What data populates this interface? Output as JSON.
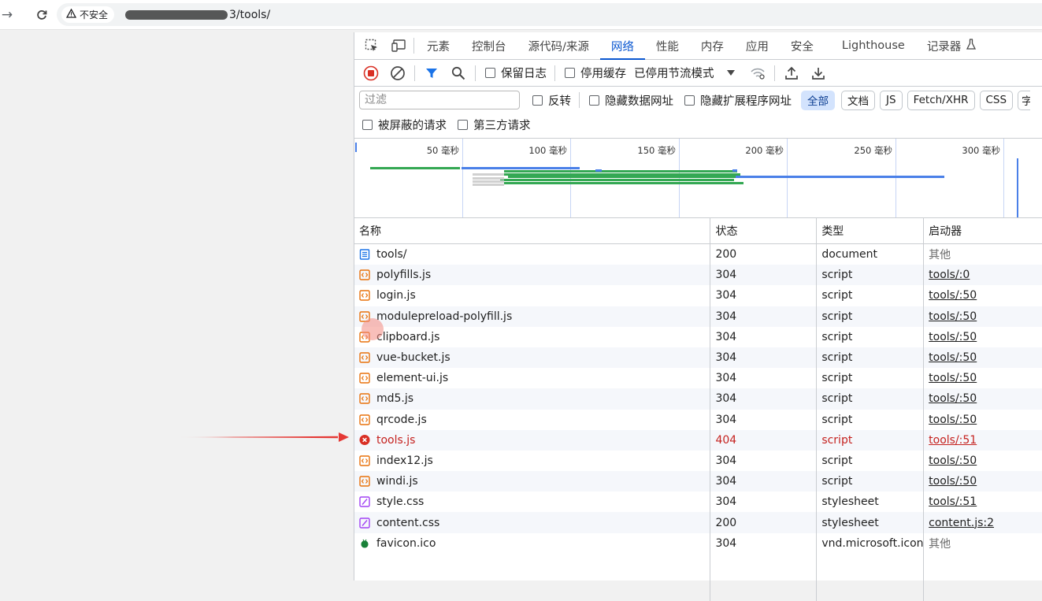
{
  "browser": {
    "security_label": "不安全",
    "url_suffix": "3/tools/"
  },
  "devtools": {
    "tabs": [
      "元素",
      "控制台",
      "源代码/来源",
      "网络",
      "性能",
      "内存",
      "应用",
      "安全",
      "Lighthouse",
      "记录器"
    ],
    "active_tab": "网络",
    "toolbar": {
      "preserve_log": "保留日志",
      "disable_cache": "停用缓存",
      "throttling": "已停用节流模式"
    },
    "filter": {
      "placeholder": "过滤",
      "invert": "反转",
      "hide_data_urls": "隐藏数据网址",
      "hide_ext_urls": "隐藏扩展程序网址",
      "types": [
        "全部",
        "文档",
        "JS",
        "Fetch/XHR",
        "CSS",
        "字"
      ],
      "active_type": "全部",
      "blocked_requests": "被屏蔽的请求",
      "third_party": "第三方请求"
    },
    "overview": {
      "ticks": [
        "50 毫秒",
        "100 毫秒",
        "150 毫秒",
        "200 毫秒",
        "250 毫秒",
        "300 毫秒"
      ]
    },
    "table": {
      "headers": [
        "名称",
        "状态",
        "类型",
        "启动器"
      ],
      "rows": [
        {
          "name": "tools/",
          "status": "200",
          "type": "document",
          "initiator": "其他",
          "icon": "document-icon",
          "kind": "doc"
        },
        {
          "name": "polyfills.js",
          "status": "304",
          "type": "script",
          "initiator": "tools/:0",
          "icon": "script-icon",
          "kind": "js"
        },
        {
          "name": "login.js",
          "status": "304",
          "type": "script",
          "initiator": "tools/:50",
          "icon": "script-icon",
          "kind": "js"
        },
        {
          "name": "modulepreload-polyfill.js",
          "status": "304",
          "type": "script",
          "initiator": "tools/:50",
          "icon": "script-icon",
          "kind": "js"
        },
        {
          "name": "clipboard.js",
          "status": "304",
          "type": "script",
          "initiator": "tools/:50",
          "icon": "script-icon",
          "kind": "js"
        },
        {
          "name": "vue-bucket.js",
          "status": "304",
          "type": "script",
          "initiator": "tools/:50",
          "icon": "script-icon",
          "kind": "js"
        },
        {
          "name": "element-ui.js",
          "status": "304",
          "type": "script",
          "initiator": "tools/:50",
          "icon": "script-icon",
          "kind": "js"
        },
        {
          "name": "md5.js",
          "status": "304",
          "type": "script",
          "initiator": "tools/:50",
          "icon": "script-icon",
          "kind": "js"
        },
        {
          "name": "qrcode.js",
          "status": "304",
          "type": "script",
          "initiator": "tools/:50",
          "icon": "script-icon",
          "kind": "js"
        },
        {
          "name": "tools.js",
          "status": "404",
          "type": "script",
          "initiator": "tools/:51",
          "icon": "error-icon",
          "kind": "err"
        },
        {
          "name": "index12.js",
          "status": "304",
          "type": "script",
          "initiator": "tools/:50",
          "icon": "script-icon",
          "kind": "js"
        },
        {
          "name": "windi.js",
          "status": "304",
          "type": "script",
          "initiator": "tools/:50",
          "icon": "script-icon",
          "kind": "js"
        },
        {
          "name": "style.css",
          "status": "304",
          "type": "stylesheet",
          "initiator": "tools/:51",
          "icon": "stylesheet-icon",
          "kind": "css"
        },
        {
          "name": "content.css",
          "status": "200",
          "type": "stylesheet",
          "initiator": "content.js:2",
          "icon": "stylesheet-icon",
          "kind": "css"
        },
        {
          "name": "favicon.ico",
          "status": "304",
          "type": "vnd.microsoft.icon",
          "initiator": "其他",
          "icon": "favicon-icon",
          "kind": "ico"
        }
      ]
    }
  },
  "colors": {
    "accent": "#0b57d0",
    "error": "#c5221f",
    "waterfall_green": "#34a853",
    "waterfall_blue": "#4a80e8"
  }
}
